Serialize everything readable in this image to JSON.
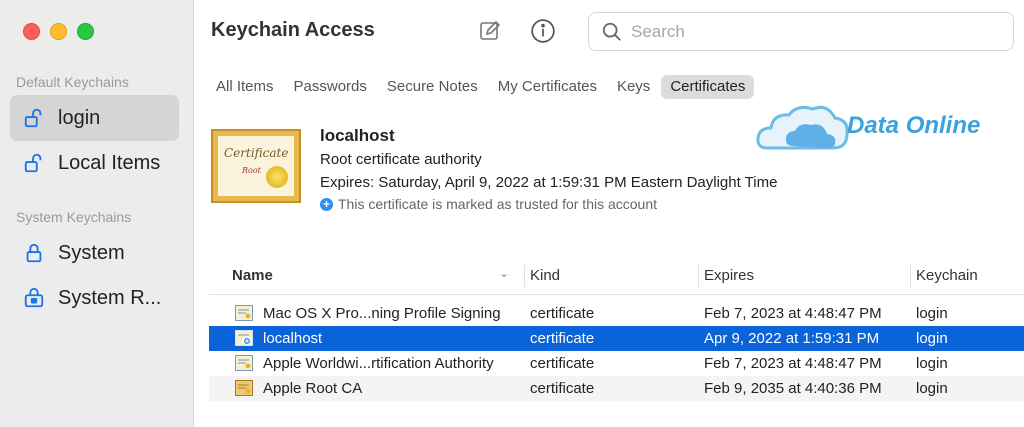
{
  "window": {
    "title": "Keychain Access",
    "traffic_lights": [
      "close",
      "minimize",
      "zoom"
    ]
  },
  "sidebar": {
    "default_section": "Default Keychains",
    "default_items": [
      {
        "label": "login",
        "icon": "unlock-icon",
        "active": true
      },
      {
        "label": "Local Items",
        "icon": "unlock-icon",
        "active": false
      }
    ],
    "system_section": "System Keychains",
    "system_items": [
      {
        "label": "System",
        "icon": "lock-icon",
        "active": false
      },
      {
        "label": "System R...",
        "icon": "locked-folder-icon",
        "active": false
      }
    ]
  },
  "toolbar": {
    "compose_icon": "compose-icon",
    "info_icon": "info-icon",
    "search_placeholder": "Search",
    "search_value": ""
  },
  "tabs": [
    {
      "label": "All Items",
      "active": false
    },
    {
      "label": "Passwords",
      "active": false
    },
    {
      "label": "Secure Notes",
      "active": false
    },
    {
      "label": "My Certificates",
      "active": false
    },
    {
      "label": "Keys",
      "active": false
    },
    {
      "label": "Certificates",
      "active": true
    }
  ],
  "selected_cert": {
    "image_text": "Certificate",
    "image_subtext": "Root",
    "name": "localhost",
    "type": "Root certificate authority",
    "expires": "Expires: Saturday, April 9, 2022 at 1:59:31 PM Eastern Daylight Time",
    "trust": "This certificate is marked as trusted for this account"
  },
  "watermark": {
    "text": "Data Online"
  },
  "table": {
    "columns": [
      "Name",
      "Kind",
      "Expires",
      "Keychain"
    ],
    "rows": [
      {
        "name": "Mac OS X Pro...ning Profile Signing",
        "kind": "certificate",
        "expires": "Feb 7, 2023 at 4:48:47 PM",
        "keychain": "login",
        "selected": false
      },
      {
        "name": "localhost",
        "kind": "certificate",
        "expires": "Apr 9, 2022 at 1:59:31 PM",
        "keychain": "login",
        "selected": true
      },
      {
        "name": "Apple Worldwi...rtification Authority",
        "kind": "certificate",
        "expires": "Feb 7, 2023 at 4:48:47 PM",
        "keychain": "login",
        "selected": false
      },
      {
        "name": "Apple Root CA",
        "kind": "certificate",
        "expires": "Feb 9, 2035 at 4:40:36 PM",
        "keychain": "login",
        "selected": false
      }
    ]
  },
  "colors": {
    "selection": "#0a63d8",
    "sidebar_bg": "#ececec",
    "watermark": "#3aa1e0"
  }
}
